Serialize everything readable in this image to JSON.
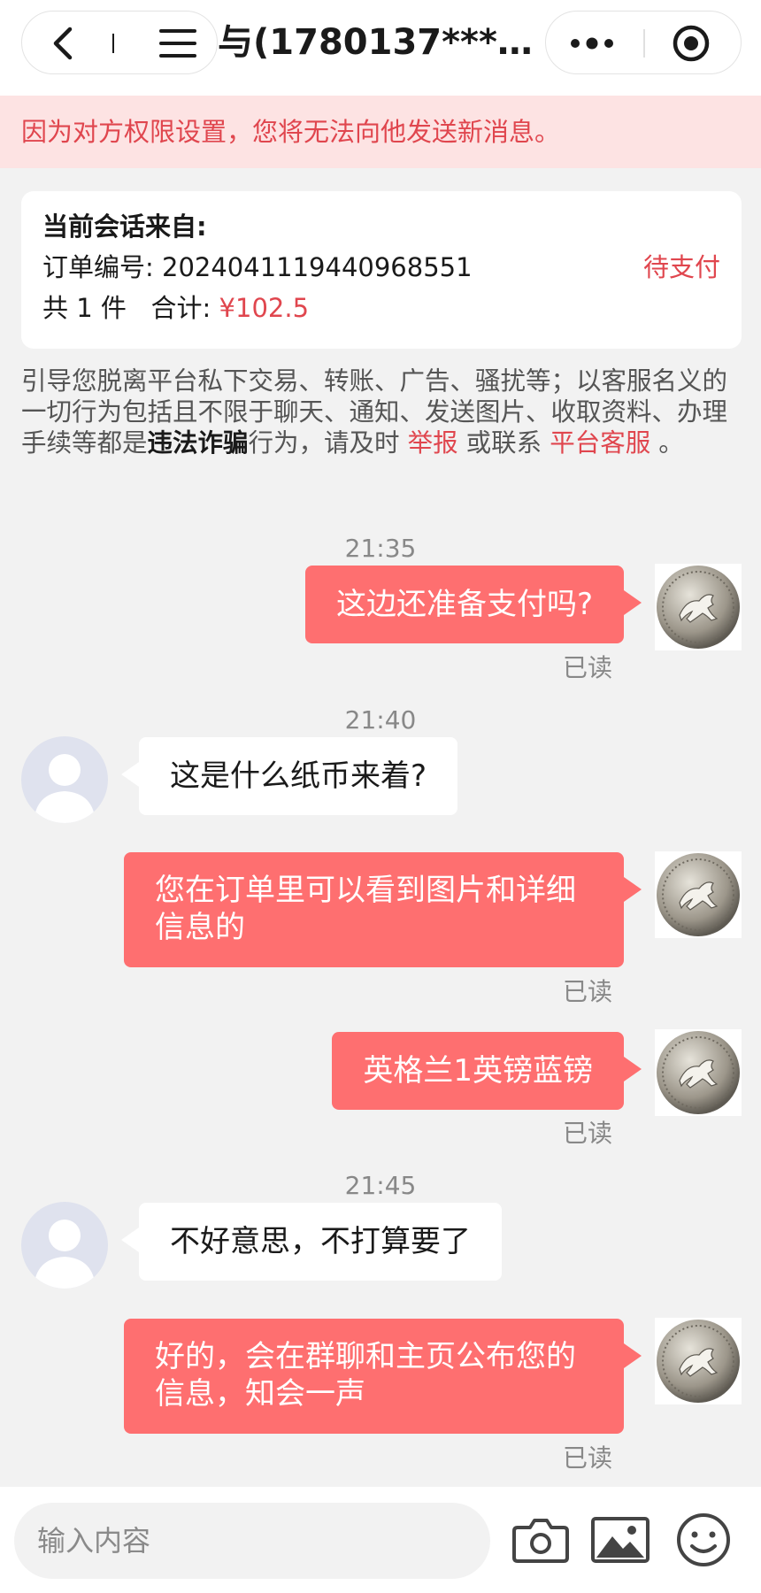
{
  "header": {
    "title": "与(1780137****…"
  },
  "notice": {
    "text": "因为对方权限设置，您将无法向他发送新消息。"
  },
  "order": {
    "heading": "当前会话来自:",
    "order_label": "订单编号:",
    "order_number": "2024041119440968551",
    "status": "待支付",
    "count_text": "共 1 件",
    "total_label": "合计:",
    "total_value": "¥102.5"
  },
  "warning": {
    "part1": "引导您脱离平台私下交易、转账、广告、骚扰等；以客服名义的一切行为包括且不限于聊天、通知、发送图片、收取资料、办理手续等都是",
    "bold": "违法诈骗",
    "part2": "行为，请及时 ",
    "report_link": "举报",
    "part3": " 或联系 ",
    "service_link": "平台客服",
    "part4": " 。"
  },
  "chat": {
    "times": [
      "21:35",
      "21:40",
      "21:45"
    ],
    "read_label": "已读",
    "messages": [
      {
        "dir": "out",
        "text": "这边还准备支付吗?"
      },
      {
        "dir": "in",
        "text": "这是什么纸币来着?"
      },
      {
        "dir": "out",
        "text": "您在订单里可以看到图片和详细信息的"
      },
      {
        "dir": "out",
        "text": "英格兰1英镑蓝镑"
      },
      {
        "dir": "in",
        "text": "不好意思，不打算要了"
      },
      {
        "dir": "out",
        "text": "好的，会在群聊和主页公布您的信息，知会一声"
      }
    ]
  },
  "input": {
    "placeholder": "输入内容"
  },
  "colors": {
    "accent": "#fe6f70",
    "alert_text": "#e0464e",
    "notice_bg": "#fde3e3",
    "page_bg": "#f2f2f2"
  },
  "icons": [
    "back-arrow-icon",
    "menu-icon",
    "more-dots-icon",
    "target-icon",
    "camera-icon",
    "image-icon",
    "emoji-icon",
    "coin-avatar-icon",
    "default-user-avatar-icon"
  ]
}
